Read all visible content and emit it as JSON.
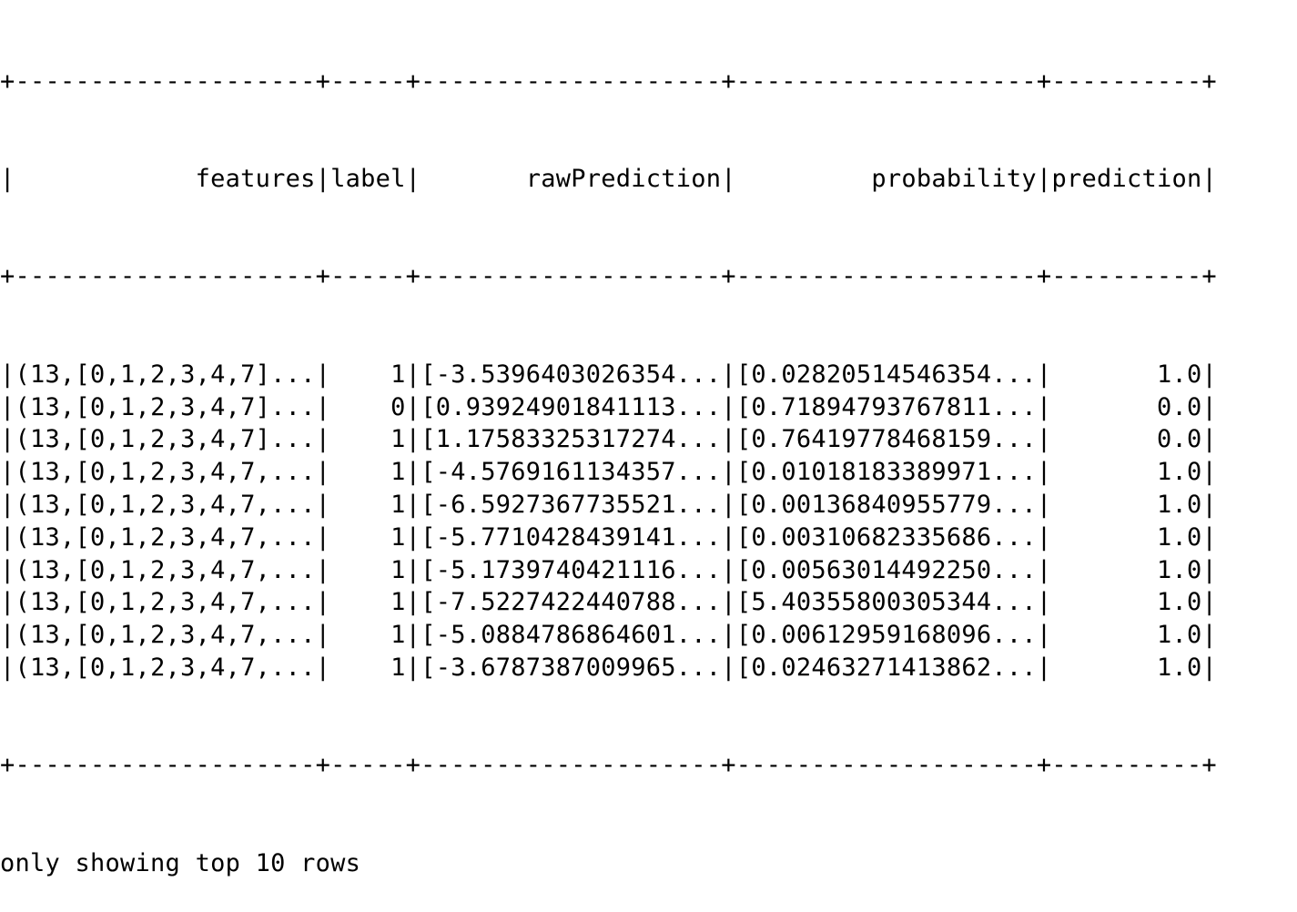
{
  "table": {
    "border_top": "+--------------------+-----+--------------------+--------------------+----------+",
    "border_mid": "+--------------------+-----+--------------------+--------------------+----------+",
    "border_bottom": "+--------------------+-----+--------------------+--------------------+----------+",
    "columns": [
      {
        "name": "features",
        "width": 20
      },
      {
        "name": "label",
        "width": 5
      },
      {
        "name": "rawPrediction",
        "width": 20
      },
      {
        "name": "probability",
        "width": 20
      },
      {
        "name": "prediction",
        "width": 10
      }
    ],
    "rows": [
      [
        "(13,[0,1,2,3,4,7]...",
        "1",
        "[-3.5396403026354...",
        "[0.02820514546354...",
        "1.0"
      ],
      [
        "(13,[0,1,2,3,4,7]...",
        "0",
        "[0.93924901841113...",
        "[0.71894793767811...",
        "0.0"
      ],
      [
        "(13,[0,1,2,3,4,7]...",
        "1",
        "[1.17583325317274...",
        "[0.76419778468159...",
        "0.0"
      ],
      [
        "(13,[0,1,2,3,4,7,...",
        "1",
        "[-4.5769161134357...",
        "[0.01018183389971...",
        "1.0"
      ],
      [
        "(13,[0,1,2,3,4,7,...",
        "1",
        "[-6.5927367735521...",
        "[0.00136840955779...",
        "1.0"
      ],
      [
        "(13,[0,1,2,3,4,7,...",
        "1",
        "[-5.7710428439141...",
        "[0.00310682335686...",
        "1.0"
      ],
      [
        "(13,[0,1,2,3,4,7,...",
        "1",
        "[-5.1739740421116...",
        "[0.00563014492250...",
        "1.0"
      ],
      [
        "(13,[0,1,2,3,4,7,...",
        "1",
        "[-7.5227422440788...",
        "[5.40355800305344...",
        "1.0"
      ],
      [
        "(13,[0,1,2,3,4,7,...",
        "1",
        "[-5.0884786864601...",
        "[0.00612959168096...",
        "1.0"
      ],
      [
        "(13,[0,1,2,3,4,7,...",
        "1",
        "[-3.6787387009965...",
        "[0.02463271413862...",
        "1.0"
      ]
    ]
  },
  "footer_text": "only showing top 10 rows"
}
